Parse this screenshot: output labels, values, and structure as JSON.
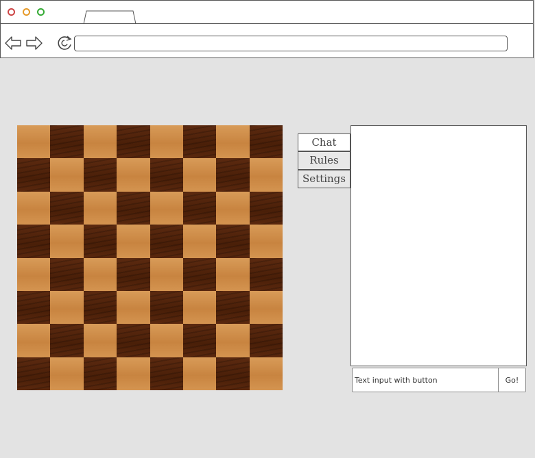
{
  "window": {
    "controls": [
      {
        "name": "close",
        "color": "#cc4444"
      },
      {
        "name": "minimize",
        "color": "#e69a2a"
      },
      {
        "name": "maximize",
        "color": "#33aa33"
      }
    ]
  },
  "toolbar": {
    "back_icon": "arrow-left-icon",
    "forward_icon": "arrow-right-icon",
    "reload_icon": "reload-icon",
    "address_value": ""
  },
  "board": {
    "rows": 8,
    "cols": 8,
    "light_color": "#d08c48",
    "dark_color": "#4f2209",
    "top_left": "light"
  },
  "side_tabs": [
    {
      "label": "Chat",
      "active": true
    },
    {
      "label": "Rules",
      "active": false
    },
    {
      "label": "Settings",
      "active": false
    }
  ],
  "chat": {
    "messages": [],
    "input_value": "Text input with button",
    "button_label": "Go!"
  }
}
